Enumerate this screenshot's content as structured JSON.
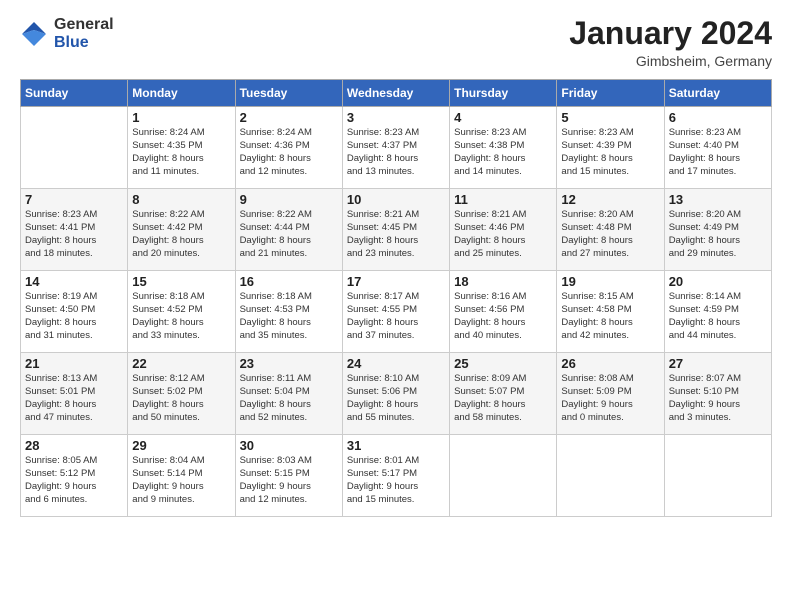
{
  "header": {
    "logo_general": "General",
    "logo_blue": "Blue",
    "month_title": "January 2024",
    "location": "Gimbsheim, Germany"
  },
  "weekdays": [
    "Sunday",
    "Monday",
    "Tuesday",
    "Wednesday",
    "Thursday",
    "Friday",
    "Saturday"
  ],
  "weeks": [
    [
      {
        "day": "",
        "info": ""
      },
      {
        "day": "1",
        "info": "Sunrise: 8:24 AM\nSunset: 4:35 PM\nDaylight: 8 hours\nand 11 minutes."
      },
      {
        "day": "2",
        "info": "Sunrise: 8:24 AM\nSunset: 4:36 PM\nDaylight: 8 hours\nand 12 minutes."
      },
      {
        "day": "3",
        "info": "Sunrise: 8:23 AM\nSunset: 4:37 PM\nDaylight: 8 hours\nand 13 minutes."
      },
      {
        "day": "4",
        "info": "Sunrise: 8:23 AM\nSunset: 4:38 PM\nDaylight: 8 hours\nand 14 minutes."
      },
      {
        "day": "5",
        "info": "Sunrise: 8:23 AM\nSunset: 4:39 PM\nDaylight: 8 hours\nand 15 minutes."
      },
      {
        "day": "6",
        "info": "Sunrise: 8:23 AM\nSunset: 4:40 PM\nDaylight: 8 hours\nand 17 minutes."
      }
    ],
    [
      {
        "day": "7",
        "info": "Sunrise: 8:23 AM\nSunset: 4:41 PM\nDaylight: 8 hours\nand 18 minutes."
      },
      {
        "day": "8",
        "info": "Sunrise: 8:22 AM\nSunset: 4:42 PM\nDaylight: 8 hours\nand 20 minutes."
      },
      {
        "day": "9",
        "info": "Sunrise: 8:22 AM\nSunset: 4:44 PM\nDaylight: 8 hours\nand 21 minutes."
      },
      {
        "day": "10",
        "info": "Sunrise: 8:21 AM\nSunset: 4:45 PM\nDaylight: 8 hours\nand 23 minutes."
      },
      {
        "day": "11",
        "info": "Sunrise: 8:21 AM\nSunset: 4:46 PM\nDaylight: 8 hours\nand 25 minutes."
      },
      {
        "day": "12",
        "info": "Sunrise: 8:20 AM\nSunset: 4:48 PM\nDaylight: 8 hours\nand 27 minutes."
      },
      {
        "day": "13",
        "info": "Sunrise: 8:20 AM\nSunset: 4:49 PM\nDaylight: 8 hours\nand 29 minutes."
      }
    ],
    [
      {
        "day": "14",
        "info": "Sunrise: 8:19 AM\nSunset: 4:50 PM\nDaylight: 8 hours\nand 31 minutes."
      },
      {
        "day": "15",
        "info": "Sunrise: 8:18 AM\nSunset: 4:52 PM\nDaylight: 8 hours\nand 33 minutes."
      },
      {
        "day": "16",
        "info": "Sunrise: 8:18 AM\nSunset: 4:53 PM\nDaylight: 8 hours\nand 35 minutes."
      },
      {
        "day": "17",
        "info": "Sunrise: 8:17 AM\nSunset: 4:55 PM\nDaylight: 8 hours\nand 37 minutes."
      },
      {
        "day": "18",
        "info": "Sunrise: 8:16 AM\nSunset: 4:56 PM\nDaylight: 8 hours\nand 40 minutes."
      },
      {
        "day": "19",
        "info": "Sunrise: 8:15 AM\nSunset: 4:58 PM\nDaylight: 8 hours\nand 42 minutes."
      },
      {
        "day": "20",
        "info": "Sunrise: 8:14 AM\nSunset: 4:59 PM\nDaylight: 8 hours\nand 44 minutes."
      }
    ],
    [
      {
        "day": "21",
        "info": "Sunrise: 8:13 AM\nSunset: 5:01 PM\nDaylight: 8 hours\nand 47 minutes."
      },
      {
        "day": "22",
        "info": "Sunrise: 8:12 AM\nSunset: 5:02 PM\nDaylight: 8 hours\nand 50 minutes."
      },
      {
        "day": "23",
        "info": "Sunrise: 8:11 AM\nSunset: 5:04 PM\nDaylight: 8 hours\nand 52 minutes."
      },
      {
        "day": "24",
        "info": "Sunrise: 8:10 AM\nSunset: 5:06 PM\nDaylight: 8 hours\nand 55 minutes."
      },
      {
        "day": "25",
        "info": "Sunrise: 8:09 AM\nSunset: 5:07 PM\nDaylight: 8 hours\nand 58 minutes."
      },
      {
        "day": "26",
        "info": "Sunrise: 8:08 AM\nSunset: 5:09 PM\nDaylight: 9 hours\nand 0 minutes."
      },
      {
        "day": "27",
        "info": "Sunrise: 8:07 AM\nSunset: 5:10 PM\nDaylight: 9 hours\nand 3 minutes."
      }
    ],
    [
      {
        "day": "28",
        "info": "Sunrise: 8:05 AM\nSunset: 5:12 PM\nDaylight: 9 hours\nand 6 minutes."
      },
      {
        "day": "29",
        "info": "Sunrise: 8:04 AM\nSunset: 5:14 PM\nDaylight: 9 hours\nand 9 minutes."
      },
      {
        "day": "30",
        "info": "Sunrise: 8:03 AM\nSunset: 5:15 PM\nDaylight: 9 hours\nand 12 minutes."
      },
      {
        "day": "31",
        "info": "Sunrise: 8:01 AM\nSunset: 5:17 PM\nDaylight: 9 hours\nand 15 minutes."
      },
      {
        "day": "",
        "info": ""
      },
      {
        "day": "",
        "info": ""
      },
      {
        "day": "",
        "info": ""
      }
    ]
  ]
}
